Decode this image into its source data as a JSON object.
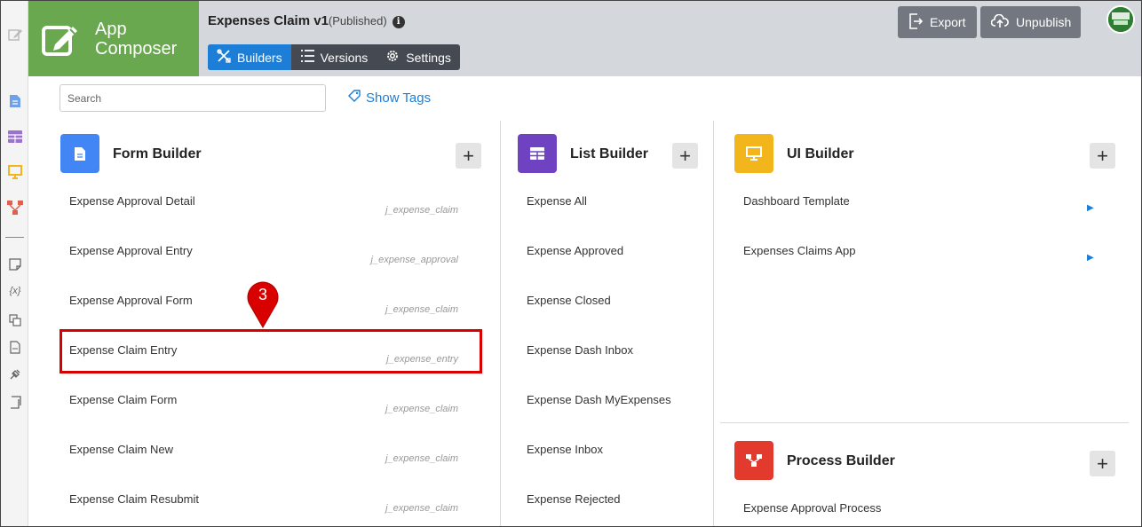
{
  "header": {
    "brand_line1": "App",
    "brand_line2": "Composer",
    "app_title": "Expenses Claim v1",
    "app_status": "(Published)",
    "tabs": [
      {
        "label": "Builders",
        "icon": "tools-icon"
      },
      {
        "label": "Versions",
        "icon": "list-icon"
      },
      {
        "label": "Settings",
        "icon": "gear-icon"
      }
    ],
    "export_label": "Export",
    "unpublish_label": "Unpublish",
    "accent_color": "#1c7ed6",
    "brand_color": "#6aa84f"
  },
  "search": {
    "placeholder": "Search",
    "show_tags_label": "Show Tags"
  },
  "form_builder": {
    "title": "Form Builder",
    "color": "#4285f4",
    "items": [
      {
        "label": "Expense Approval Detail",
        "tag": "j_expense_claim"
      },
      {
        "label": "Expense Approval Entry",
        "tag": "j_expense_approval"
      },
      {
        "label": "Expense Approval Form",
        "tag": "j_expense_claim"
      },
      {
        "label": "Expense Claim Entry",
        "tag": "j_expense_entry"
      },
      {
        "label": "Expense Claim Form",
        "tag": "j_expense_claim"
      },
      {
        "label": "Expense Claim New",
        "tag": "j_expense_claim"
      },
      {
        "label": "Expense Claim Resubmit",
        "tag": "j_expense_claim"
      }
    ]
  },
  "list_builder": {
    "title": "List Builder",
    "color": "#6f42c1",
    "items": [
      {
        "label": "Expense All"
      },
      {
        "label": "Expense Approved"
      },
      {
        "label": "Expense Closed"
      },
      {
        "label": "Expense Dash Inbox"
      },
      {
        "label": "Expense Dash MyExpenses"
      },
      {
        "label": "Expense Inbox"
      },
      {
        "label": "Expense Rejected"
      }
    ]
  },
  "ui_builder": {
    "title": "UI Builder",
    "color": "#f3b51c",
    "items": [
      {
        "label": "Dashboard Template"
      },
      {
        "label": "Expenses Claims App"
      }
    ]
  },
  "process_builder": {
    "title": "Process Builder",
    "color": "#e23b2e",
    "items": [
      {
        "label": "Expense Approval Process"
      }
    ]
  },
  "annotation": {
    "step_number": "3",
    "highlight_color": "#d90000"
  }
}
